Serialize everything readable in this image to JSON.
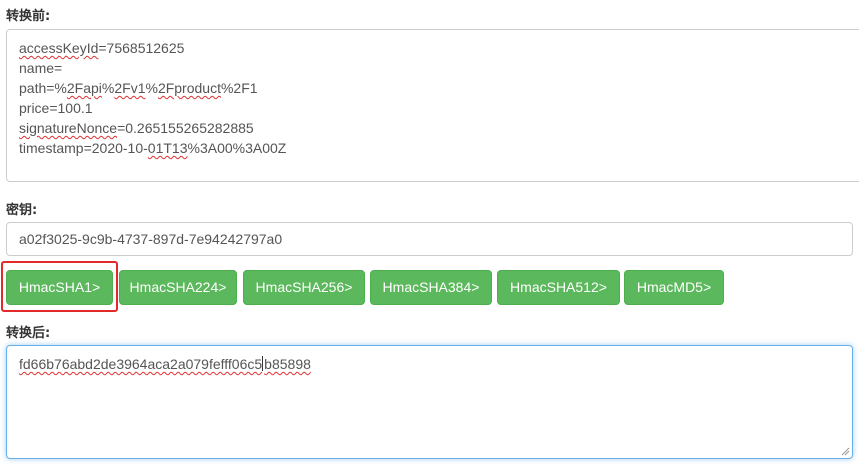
{
  "input_section": {
    "label": "转换前:",
    "lines": [
      {
        "prefix": "",
        "squiggle": "accessKeyId",
        "suffix": "=7568512625"
      },
      {
        "prefix": "name=",
        "squiggle": "",
        "suffix": ""
      },
      {
        "prefix": "path=%",
        "squiggle": "2Fapi",
        "mid": "%",
        "squiggle2": "2Fv1",
        "mid2": "%",
        "squiggle3": "2Fproduct",
        "suffix": "%2F1"
      },
      {
        "prefix": "price=100.1",
        "squiggle": "",
        "suffix": ""
      },
      {
        "prefix": "",
        "squiggle": "signatureNonce",
        "suffix": "=0.265155265282885"
      },
      {
        "prefix": "timestamp=2020-10-",
        "squiggle": "01T13",
        "suffix": "%3A00%3A00Z"
      }
    ]
  },
  "key_section": {
    "label": "密钥:",
    "value": "a02f3025-9c9b-4737-897d-7e94242797a0"
  },
  "buttons": [
    {
      "label": "HmacSHA1>"
    },
    {
      "label": "HmacSHA224>"
    },
    {
      "label": "HmacSHA256>"
    },
    {
      "label": "HmacSHA384>"
    },
    {
      "label": "HmacSHA512>"
    },
    {
      "label": "HmacMD5>"
    }
  ],
  "output_section": {
    "label": "转换后:",
    "value_before_caret": "fd66b76abd2de3964aca2a079fefff06c5",
    "value_after_caret": "b85898"
  },
  "colors": {
    "button_bg": "#5cb85c",
    "highlight_border": "#e32a2a",
    "focus_border": "#66afe9"
  }
}
